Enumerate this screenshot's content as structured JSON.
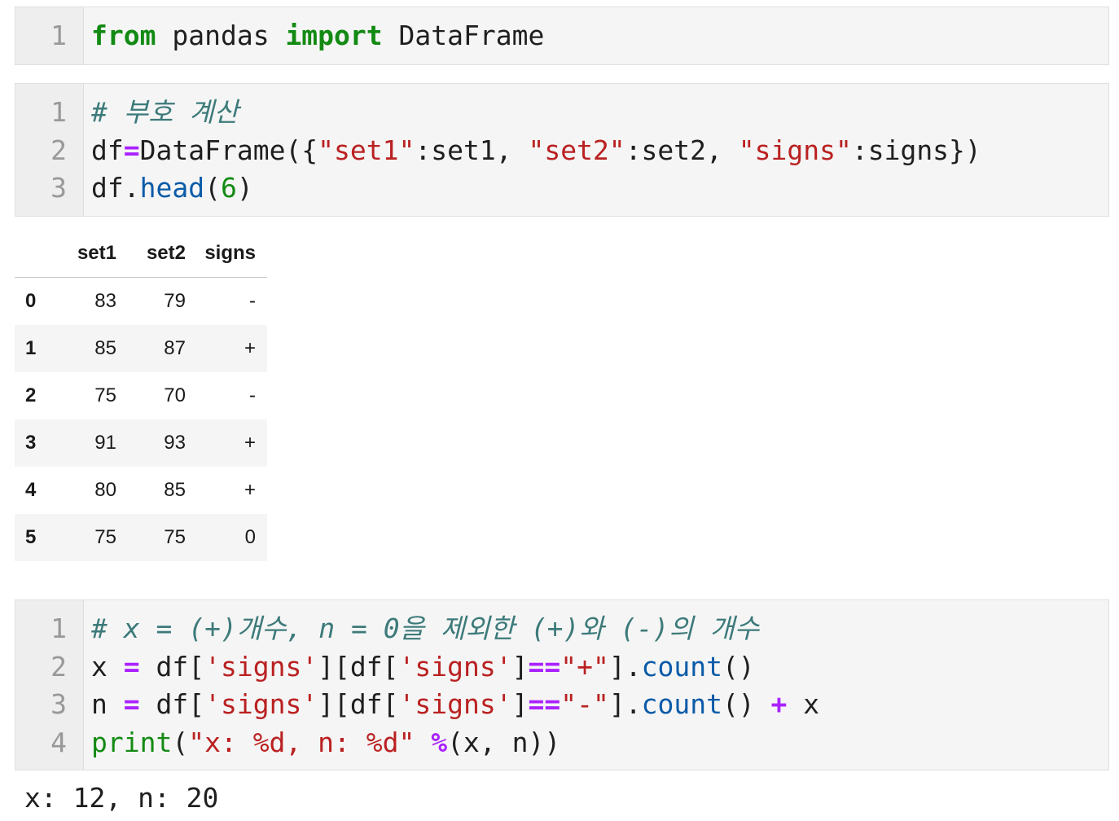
{
  "cell1": {
    "line_numbers": [
      "1"
    ],
    "tokens": {
      "from": "from",
      "mod": " pandas ",
      "import": "import",
      "name": " DataFrame"
    }
  },
  "cell2": {
    "line_numbers": [
      "1",
      "2",
      "3"
    ],
    "comment": "# 부호 계산",
    "l2": {
      "a": "df",
      "eq": "=",
      "b": "DataFrame({",
      "s1": "\"set1\"",
      "c": ":set1, ",
      "s2": "\"set2\"",
      "d": ":set2, ",
      "s3": "\"signs\"",
      "e": ":signs})"
    },
    "l3": {
      "a": "df.",
      "fn": "head",
      "b": "(",
      "num": "6",
      "c": ")"
    }
  },
  "dataframe": {
    "columns": [
      "set1",
      "set2",
      "signs"
    ],
    "rows": [
      {
        "index": "0",
        "set1": "83",
        "set2": "79",
        "signs": "-"
      },
      {
        "index": "1",
        "set1": "85",
        "set2": "87",
        "signs": "+"
      },
      {
        "index": "2",
        "set1": "75",
        "set2": "70",
        "signs": "-"
      },
      {
        "index": "3",
        "set1": "91",
        "set2": "93",
        "signs": "+"
      },
      {
        "index": "4",
        "set1": "80",
        "set2": "85",
        "signs": "+"
      },
      {
        "index": "5",
        "set1": "75",
        "set2": "75",
        "signs": "0"
      }
    ]
  },
  "cell3": {
    "line_numbers": [
      "1",
      "2",
      "3",
      "4"
    ],
    "comment": "# x = (+)개수, n = 0을 제외한 (+)와 (-)의 개수",
    "l2": {
      "a": "x ",
      "eq": "=",
      "b": " df[",
      "s1": "'signs'",
      "c": "][df[",
      "s2": "'signs'",
      "d": "]",
      "eqeq": "==",
      "s3": "\"+\"",
      "e": "].",
      "fn": "count",
      "f": "()"
    },
    "l3": {
      "a": "n ",
      "eq": "=",
      "b": " df[",
      "s1": "'signs'",
      "c": "][df[",
      "s2": "'signs'",
      "d": "]",
      "eqeq": "==",
      "s3": "\"-\"",
      "e": "].",
      "fn": "count",
      "f": "() ",
      "plus": "+",
      "g": " x"
    },
    "l4": {
      "fn": "print",
      "a": "(",
      "s1": "\"x: %d, n: %d\"",
      "b": " ",
      "pct": "%",
      "c": "(x, n))"
    }
  },
  "output": "x: 12, n: 20"
}
